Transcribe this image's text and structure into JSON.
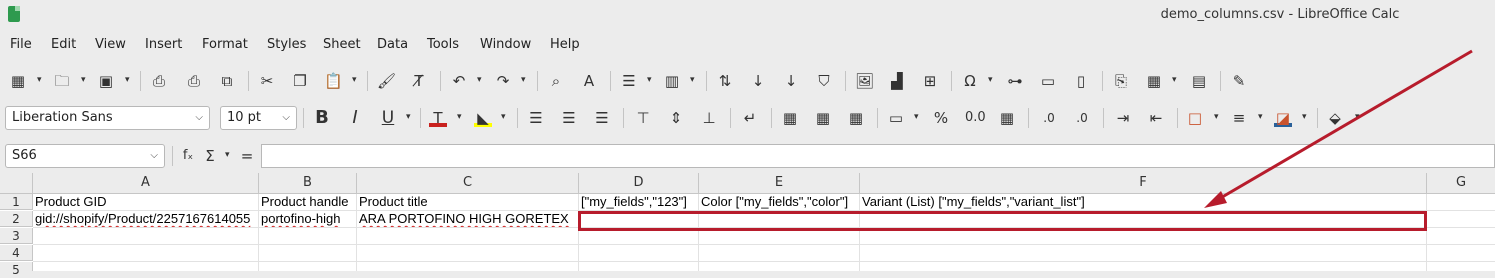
{
  "window": {
    "title": "demo_columns.csv - LibreOffice Calc"
  },
  "menu": [
    "File",
    "Edit",
    "View",
    "Insert",
    "Format",
    "Styles",
    "Sheet",
    "Data",
    "Tools",
    "Window",
    "Help"
  ],
  "formatting": {
    "font_name": "Liberation Sans",
    "font_size": "10 pt"
  },
  "formula_bar": {
    "name_box": "S66",
    "fx_label": "fₓ",
    "sum_label": "Σ",
    "equals_label": "=",
    "content": ""
  },
  "sheet": {
    "columns": [
      "A",
      "B",
      "C",
      "D",
      "E",
      "F",
      "G"
    ],
    "rows": [
      "1",
      "2",
      "3",
      "4",
      "5"
    ],
    "cells": {
      "A1": "Product GID",
      "B1": "Product handle",
      "C1": "Product title",
      "D1": "[\"my_fields\",\"123\"]",
      "E1": "Color [\"my_fields\",\"color\"]",
      "F1": "Variant (List) [\"my_fields\",\"variant_list\"]",
      "A2": "gid://shopify/Product/2257167614055",
      "B2": "portofino-high",
      "C2": "ARA PORTOFINO HIGH GORETEX"
    }
  },
  "annotation": {
    "color": "#b71c2c"
  }
}
